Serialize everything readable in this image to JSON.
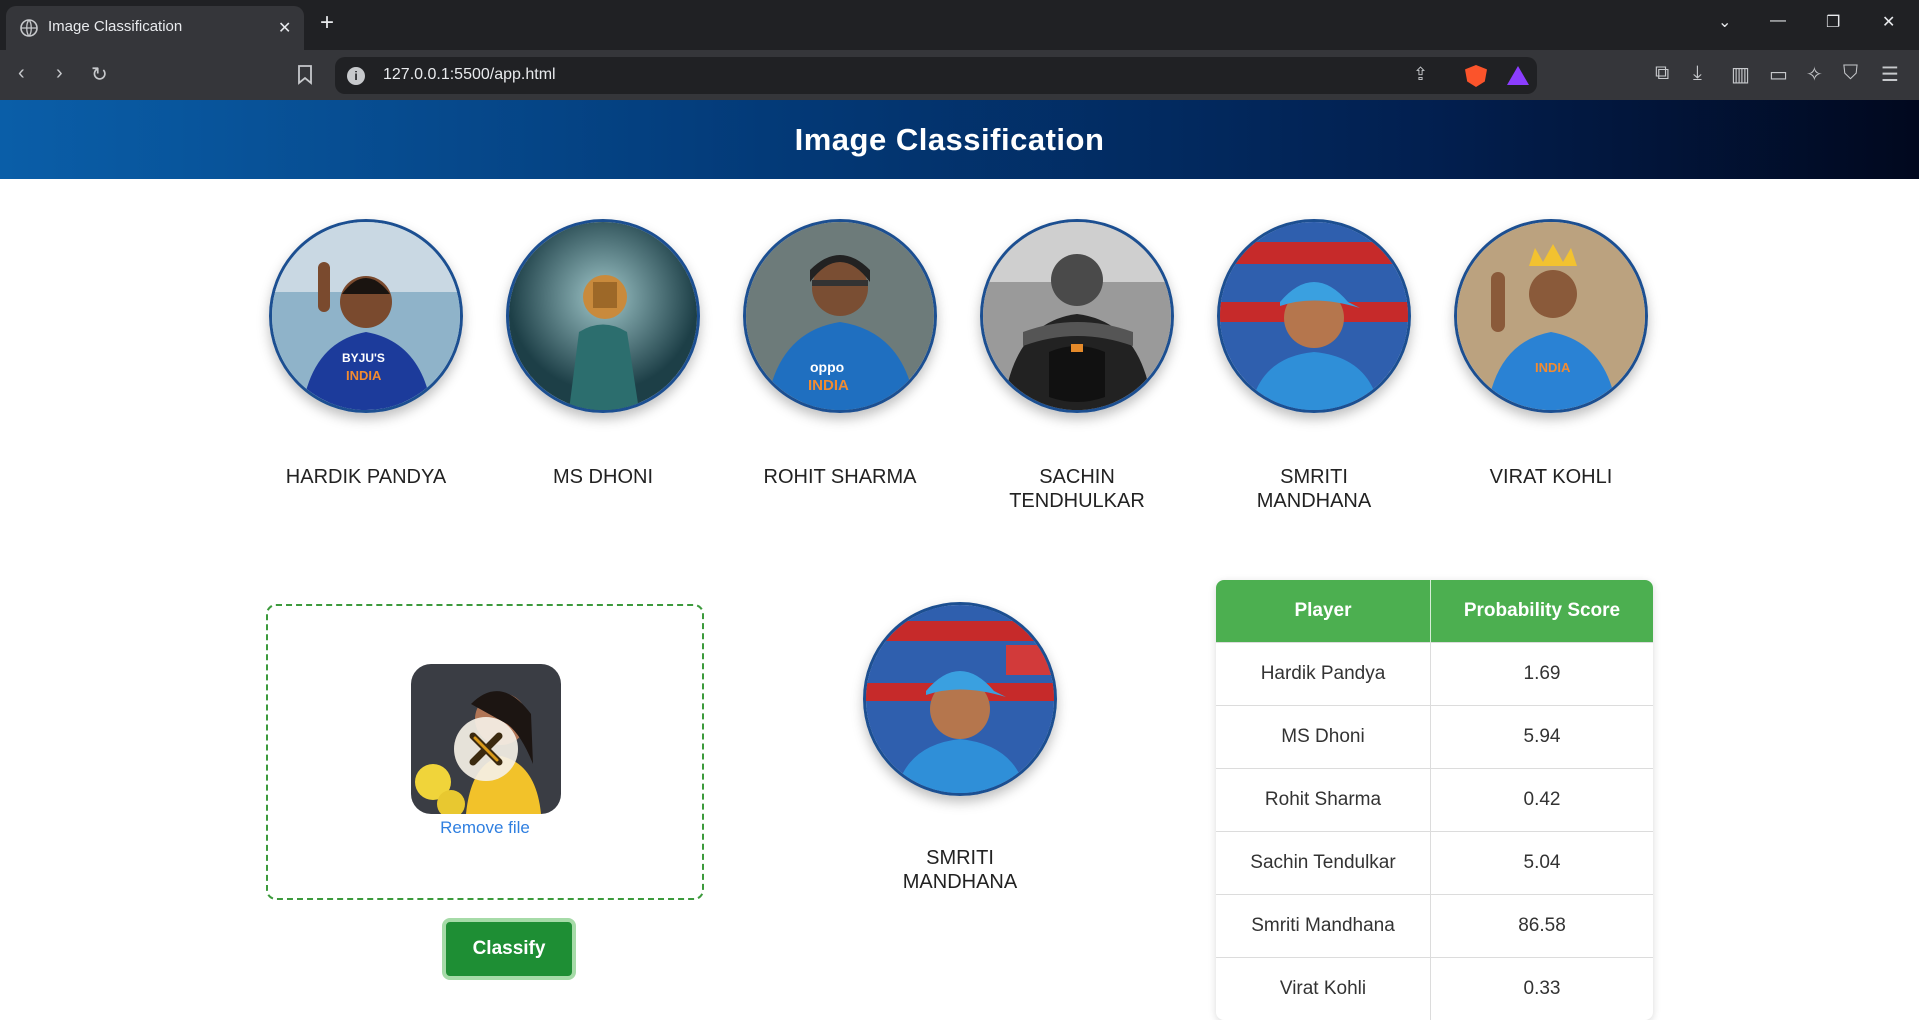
{
  "browser": {
    "tab_title": "Image Classification",
    "url": "127.0.0.1:5500/app.html"
  },
  "page": {
    "title": "Image Classification"
  },
  "players": [
    {
      "name": "HARDIK PANDYA"
    },
    {
      "name": "MS DHONI"
    },
    {
      "name": "ROHIT SHARMA"
    },
    {
      "name": "SACHIN TENDHULKAR"
    },
    {
      "name": "SMRITI MANDHANA"
    },
    {
      "name": "VIRAT KOHLI"
    }
  ],
  "upload": {
    "remove_label": "Remove file",
    "classify_label": "Classify"
  },
  "result": {
    "name": "SMRITI MANDHANA"
  },
  "table": {
    "headers": [
      "Player",
      "Probability Score"
    ],
    "rows": [
      {
        "player": "Hardik Pandya",
        "score": "1.69"
      },
      {
        "player": "MS Dhoni",
        "score": "5.94"
      },
      {
        "player": "Rohit Sharma",
        "score": "0.42"
      },
      {
        "player": "Sachin Tendulkar",
        "score": "5.04"
      },
      {
        "player": "Smriti Mandhana",
        "score": "86.58"
      },
      {
        "player": "Virat Kohli",
        "score": "0.33"
      }
    ]
  },
  "colors": {
    "header_gradient_start": "#0a5ea8",
    "header_gradient_end": "#01081e",
    "table_header": "#4caf50",
    "classify_button": "#1e8e34",
    "avatar_border": "#1c4f91"
  }
}
